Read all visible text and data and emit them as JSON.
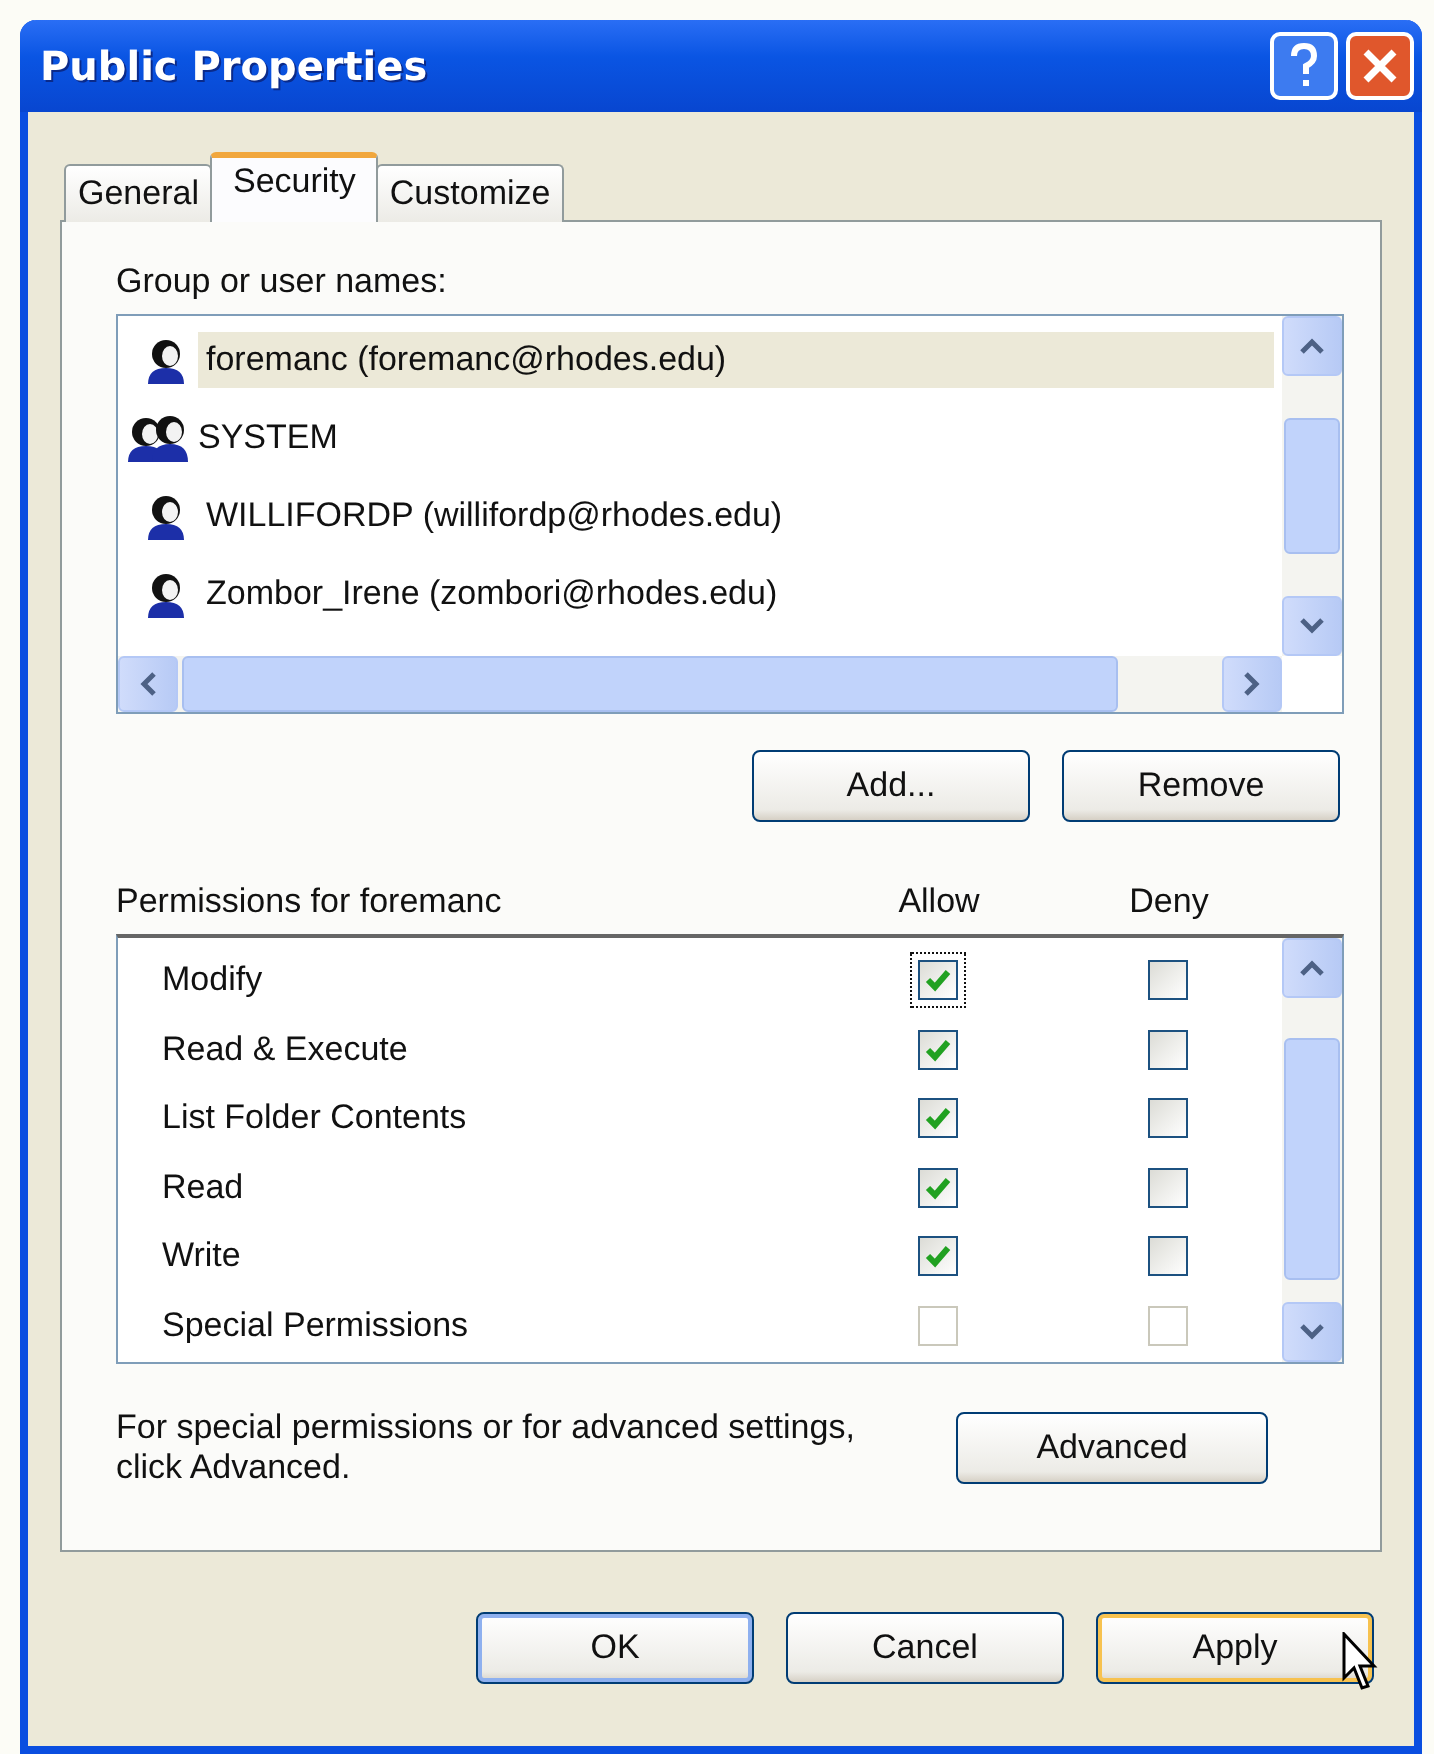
{
  "window": {
    "title": "Public Properties"
  },
  "tabs": [
    {
      "label": "General",
      "selected": false
    },
    {
      "label": "Security",
      "selected": true
    },
    {
      "label": "Customize",
      "selected": false
    }
  ],
  "users": {
    "label": "Group or user names:",
    "items": [
      {
        "name": "foremanc (foremanc@rhodes.edu)",
        "kind": "user",
        "selected": true
      },
      {
        "name": "SYSTEM",
        "kind": "group",
        "selected": false
      },
      {
        "name": "WILLIFORDP (willifordp@rhodes.edu)",
        "kind": "user",
        "selected": false
      },
      {
        "name": "Zombor_Irene (zombori@rhodes.edu)",
        "kind": "user",
        "selected": false
      }
    ]
  },
  "user_buttons": [
    {
      "label": "Add..."
    },
    {
      "label": "Remove"
    }
  ],
  "permissions": {
    "label": "Permissions for foremanc",
    "allow_header": "Allow",
    "deny_header": "Deny",
    "items": [
      {
        "name": "Modify",
        "allow": {
          "checked": true,
          "disabled": false,
          "focused": true
        },
        "deny": {
          "checked": false,
          "disabled": false,
          "focused": false
        }
      },
      {
        "name": "Read & Execute",
        "allow": {
          "checked": true,
          "disabled": false,
          "focused": false
        },
        "deny": {
          "checked": false,
          "disabled": false,
          "focused": false
        }
      },
      {
        "name": "List Folder Contents",
        "allow": {
          "checked": true,
          "disabled": false,
          "focused": false
        },
        "deny": {
          "checked": false,
          "disabled": false,
          "focused": false
        }
      },
      {
        "name": "Read",
        "allow": {
          "checked": true,
          "disabled": false,
          "focused": false
        },
        "deny": {
          "checked": false,
          "disabled": false,
          "focused": false
        }
      },
      {
        "name": "Write",
        "allow": {
          "checked": true,
          "disabled": false,
          "focused": false
        },
        "deny": {
          "checked": false,
          "disabled": false,
          "focused": false
        }
      },
      {
        "name": "Special Permissions",
        "allow": {
          "checked": false,
          "disabled": true,
          "focused": false
        },
        "deny": {
          "checked": false,
          "disabled": true,
          "focused": false
        }
      }
    ]
  },
  "advanced": {
    "note": "For special permissions or for advanced settings, click Advanced.",
    "button": "Advanced"
  },
  "buttons": [
    {
      "label": "OK",
      "default": true,
      "hovered": false
    },
    {
      "label": "Cancel",
      "default": false,
      "hovered": false
    },
    {
      "label": "Apply",
      "default": false,
      "hovered": true
    }
  ]
}
